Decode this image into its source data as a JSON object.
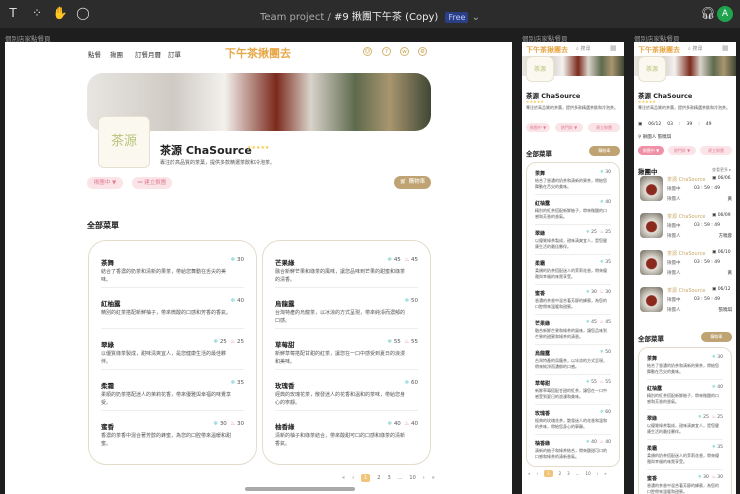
{
  "toolbar": {
    "project": "Team project",
    "separator": "/",
    "file": "#9 揪團下午茶 (Copy)",
    "plan": "Free",
    "avatar": "A"
  },
  "frames": {
    "desktop_label": "個別店家點餐頁",
    "mobile1_label": "個別店家點餐頁",
    "mobile2_label": "個別店家點餐頁"
  },
  "site": {
    "brand": "下午茶揪團去",
    "nav": [
      "點餐",
      "揪團",
      "訂餐月曆",
      "訂單"
    ],
    "search_placeholder": "搜尋"
  },
  "store": {
    "name": "茶源 ChaSource",
    "logo_text": "茶源",
    "rating": "★★★★★",
    "desc": "專注於高品質的茶葉，提供多款精選茶飲和冷泡茶。",
    "btn_group": "揪團中 ▼",
    "btn_hot": "熱門款 ▼",
    "btn_create": "建立揪團",
    "cart": "購物車"
  },
  "menu": {
    "title": "全部菜單",
    "left": [
      {
        "name": "茶舞",
        "cold": "30",
        "hot": "",
        "desc": "結合了香濃的奶茶和清新的果茶，帶給您舞動在舌尖的美味。"
      },
      {
        "name": "紅柚露",
        "cold": "40",
        "hot": "",
        "desc": "精別的紅茶搭配新鮮柚子，帶來微酸的口感和芳香的香氣。"
      },
      {
        "name": "翠綠",
        "cold": "25",
        "hot": "25",
        "desc": "以優質綠茶製成，甜味清爽宜人，是您健康生活的最佳夥伴。"
      },
      {
        "name": "柔霜",
        "cold": "35",
        "hot": "",
        "desc": "柔順的奶茶搭配迷人的茉莉花香，帶來優雅與幸福的味覺享受。"
      },
      {
        "name": "蜜香",
        "cold": "30",
        "hot": "30",
        "desc": "香濃的茶香中混合著芳醇的蜂蜜，為您的口腔帶來溫暖和甜蜜。"
      }
    ],
    "right": [
      {
        "name": "芒果綠",
        "cold": "45",
        "hot": "45",
        "desc": "融合新鮮芒果和綠茶的風味，讓您品味到芒果的甜蜜和綠茶的清香。"
      },
      {
        "name": "烏龍露",
        "cold": "50",
        "hot": "",
        "desc": "台灣特產的烏龍茶，以冰涼的方式呈現，帶來純淨而濃郁的口感。"
      },
      {
        "name": "草莓甜",
        "cold": "55",
        "hot": "55",
        "desc": "新鮮草莓搭配甘甜的紅茶，讓您在一口中感受到夏日的浪漫和美味。"
      },
      {
        "name": "玫瑰香",
        "cold": "60",
        "hot": "",
        "desc": "經典的玫瑰花茶，散發迷人的花香和溫和的茶味，帶給您身心的寧靜。"
      },
      {
        "name": "柚香綠",
        "cold": "40",
        "hot": "40",
        "desc": "清新的柚子和綠茶結合，帶來酸甜可口的口感和綠茶的清新香氣。"
      }
    ]
  },
  "pagination": [
    "«",
    "‹",
    "1",
    "2",
    "3",
    "...",
    "10",
    "›",
    "»"
  ],
  "mobile_pagination": [
    "«",
    "‹",
    "1",
    "2",
    "3",
    "...",
    "10",
    "›",
    "»"
  ],
  "group": {
    "date": "06/12",
    "h": "03",
    "m": "39",
    "s": "49",
    "leader_label": "揪團人",
    "leader": "張曉琪",
    "title": "揪團中",
    "more": "查看更多 ▸",
    "list": [
      {
        "store": "茶源 ChaSource",
        "date": "06/06",
        "status": "揪團中",
        "time": "03 : 59 : 49",
        "leader_label": "揪團人",
        "leader": "黃"
      },
      {
        "store": "茶源 ChaSource",
        "date": "06/09",
        "status": "揪團中",
        "time": "03 : 59 : 49",
        "leader_label": "揪團人",
        "leader": "方曉蓉"
      },
      {
        "store": "茶源 ChaSource",
        "date": "06/10",
        "status": "揪團中",
        "time": "03 : 59 : 49",
        "leader_label": "揪團人",
        "leader": "黃"
      },
      {
        "store": "茶源 ChaSource",
        "date": "06/12",
        "status": "揪團中",
        "time": "03 : 59 : 49",
        "leader_label": "揪團人",
        "leader": "張曉琪"
      }
    ]
  },
  "colors": {
    "brand": "#e7a84a",
    "cart": "#bfa372",
    "pill": "#fbe4e8",
    "cold": "#5ec8c8",
    "hot": "#e47996"
  }
}
